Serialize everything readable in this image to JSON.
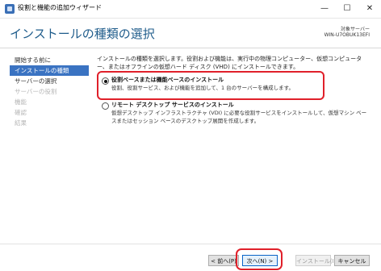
{
  "window": {
    "title": "役割と機能の追加ウィザード",
    "minimize_glyph": "—",
    "maximize_glyph": "☐",
    "close_glyph": "✕"
  },
  "header": {
    "page_title": "インストールの種類の選択",
    "destination_label": "対象サーバー",
    "destination_server": "WIN-U7OBUK13EFI"
  },
  "sidebar": {
    "items": [
      {
        "label": "開始する前に"
      },
      {
        "label": "インストールの種類"
      },
      {
        "label": "サーバーの選択"
      },
      {
        "label": "サーバーの役割"
      },
      {
        "label": "機能"
      },
      {
        "label": "確認"
      },
      {
        "label": "結果"
      }
    ]
  },
  "main": {
    "intro": "インストールの種類を選択します。役割および機能は、実行中の物理コンピューター、仮想コンピューター、またはオフラインの仮想ハード ディスク (VHD) にインストールできます。",
    "options": [
      {
        "label": "役割ベースまたは機能ベースのインストール",
        "description": "役割、役割サービス、および機能を追加して、1 台のサーバーを構成します。",
        "selected": true
      },
      {
        "label": "リモート デスクトップ サービスのインストール",
        "description": "仮想デスクトップ インフラストラクチャ (VDI) に必要な役割サービスをインストールして、仮想マシン ベースまたはセッション ベースのデスクトップ展開を作成します。",
        "selected": false
      }
    ]
  },
  "buttons": {
    "prev": "< 前へ(P)",
    "next": "次へ(N) >",
    "install": "インストール(I)",
    "cancel": "キャンセル"
  },
  "colors": {
    "accent": "#3a73c2",
    "title": "#1f5c8b",
    "highlight": "#e0202a"
  }
}
